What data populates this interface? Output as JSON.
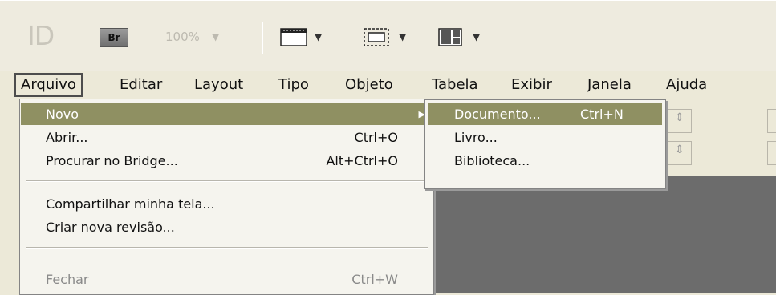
{
  "toolbar": {
    "logo": "ID",
    "bridge_label": "Br",
    "zoom_value": "100%",
    "icons": [
      "screen-mode-icon",
      "view-options-icon",
      "arrange-documents-icon"
    ]
  },
  "menubar": {
    "items": [
      "Arquivo",
      "Editar",
      "Layout",
      "Tipo",
      "Objeto",
      "Tabela",
      "Exibir",
      "Janela",
      "Ajuda"
    ],
    "active": "Arquivo"
  },
  "file_menu": {
    "items": [
      {
        "label": "Novo",
        "shortcut": "",
        "has_submenu": true,
        "highlighted": true
      },
      {
        "label": "Abrir...",
        "shortcut": "Ctrl+O"
      },
      {
        "label": "Procurar no Bridge...",
        "shortcut": "Alt+Ctrl+O"
      },
      {
        "label": "Compartilhar minha tela..."
      },
      {
        "label": "Criar nova revisão..."
      },
      {
        "label": "Fechar",
        "shortcut": "Ctrl+W",
        "disabled": true
      }
    ]
  },
  "new_submenu": {
    "items": [
      {
        "label": "Documento...",
        "shortcut": "Ctrl+N",
        "highlighted": true
      },
      {
        "label": "Livro..."
      },
      {
        "label": "Biblioteca..."
      }
    ]
  },
  "colors": {
    "highlight": "#8f9062",
    "menu_bg": "#f5f4ee",
    "chrome_bg": "#ece9d8",
    "workspace": "#6c6c6c"
  }
}
